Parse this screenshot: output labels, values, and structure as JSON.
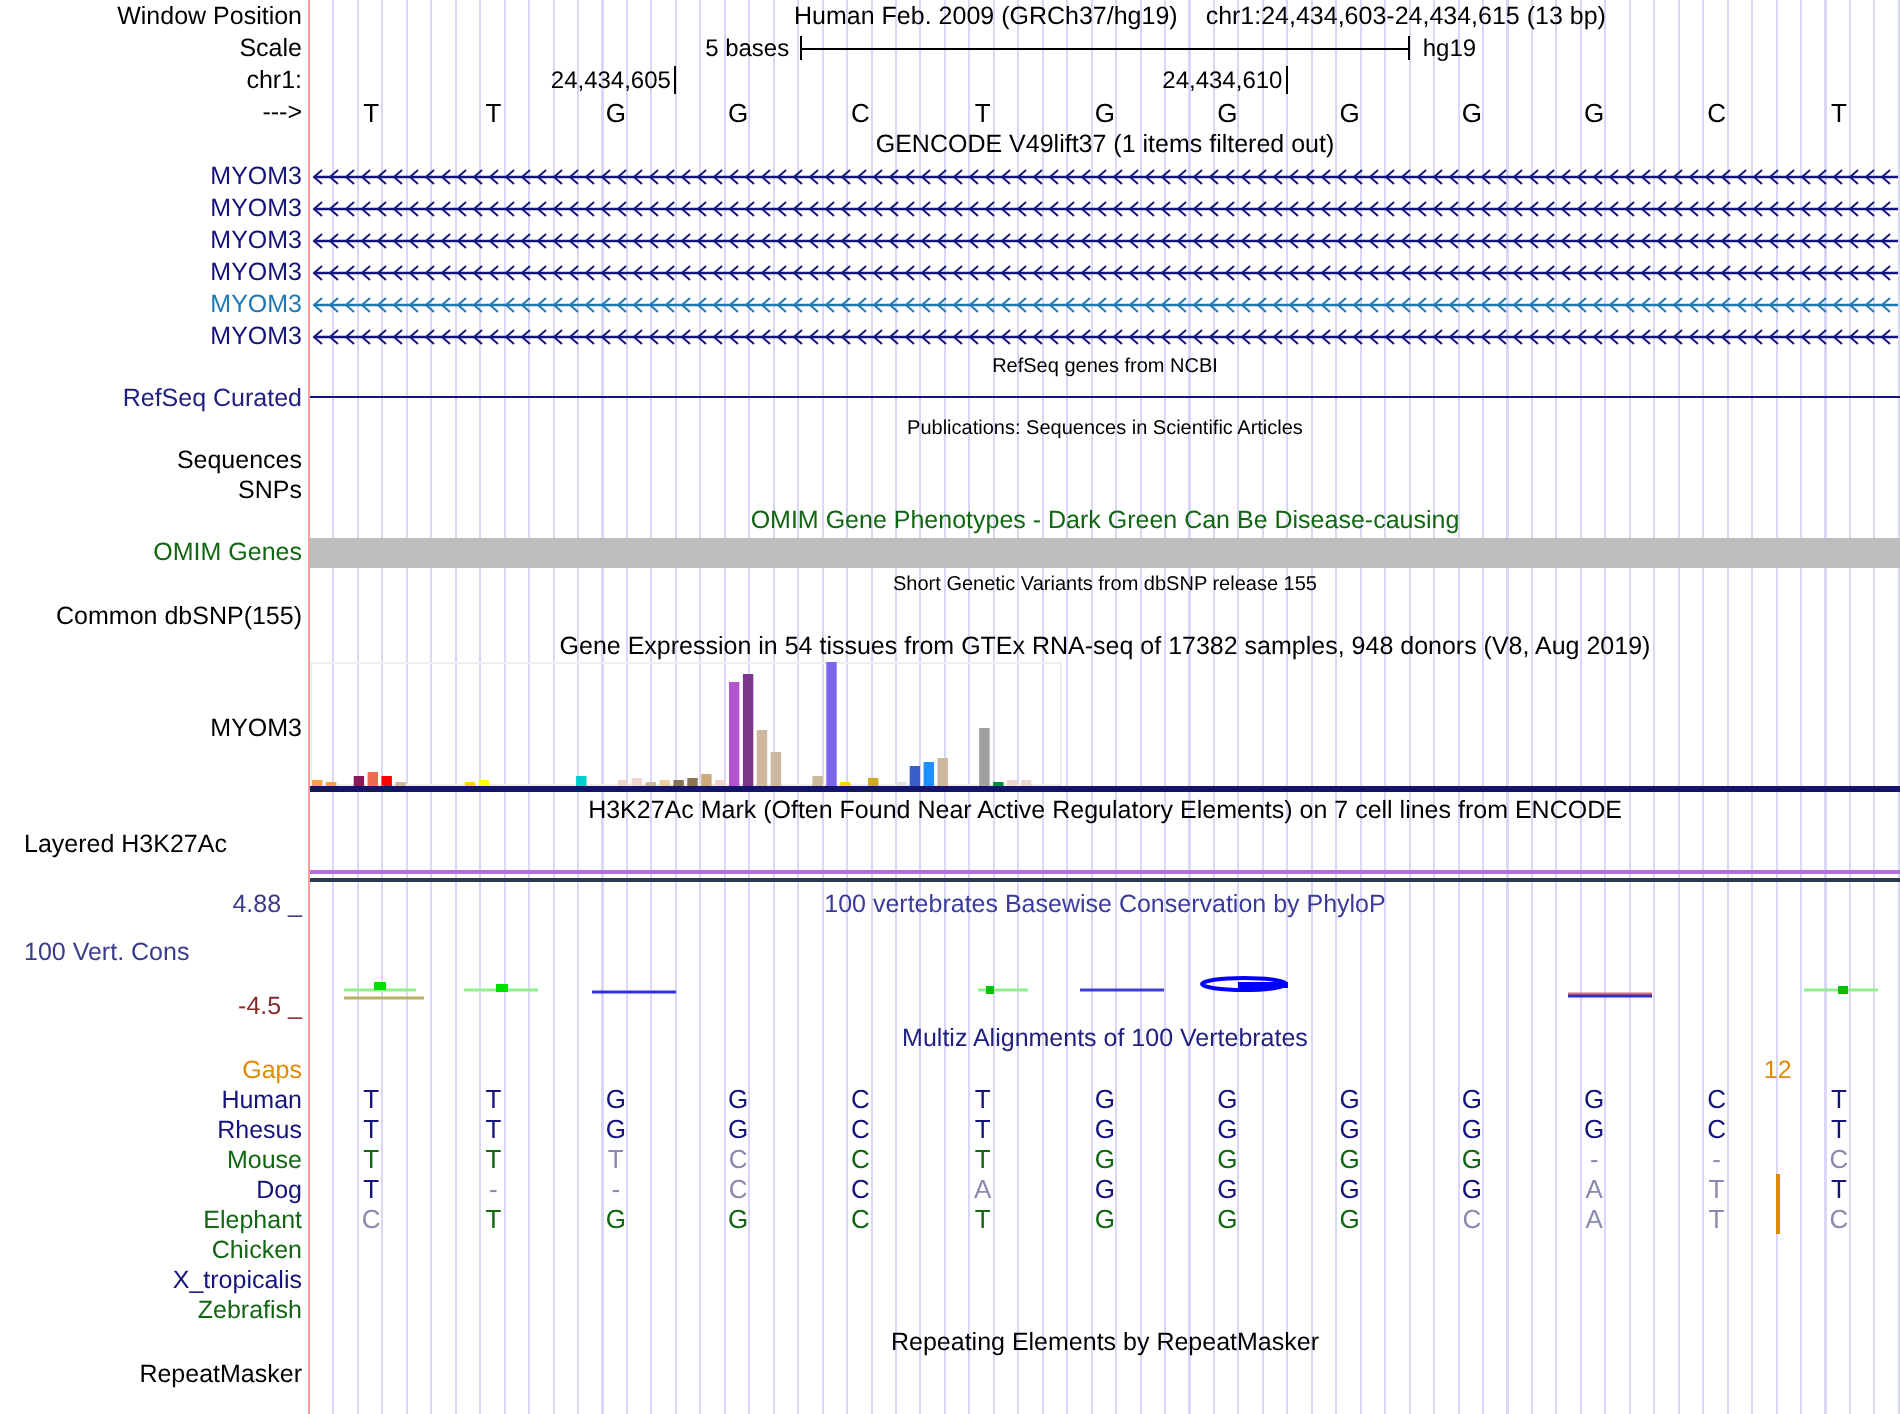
{
  "position_bar": {
    "label": "Window Position",
    "assembly": "Human Feb. 2009 (GRCh37/hg19)",
    "range": "chr1:24,434,603-24,434,615 (13 bp)"
  },
  "scale_bar": {
    "label": "Scale",
    "span": "5 bases",
    "database": "hg19"
  },
  "coordinate_bar": {
    "label": "chr1:",
    "ticks": [
      "24,434,605",
      "24,434,610"
    ]
  },
  "base_row": {
    "label": "--->",
    "bases": [
      "T",
      "T",
      "G",
      "G",
      "C",
      "T",
      "G",
      "G",
      "G",
      "G",
      "G",
      "C",
      "T"
    ]
  },
  "tracks": [
    {
      "kind": "genes",
      "title": "GENCODE V49lift37 (1 items filtered out)",
      "items": [
        {
          "label": "MYOM3",
          "color": "#14147a"
        },
        {
          "label": "MYOM3",
          "color": "#14147a"
        },
        {
          "label": "MYOM3",
          "color": "#14147a"
        },
        {
          "label": "MYOM3",
          "color": "#14147a"
        },
        {
          "label": "MYOM3",
          "color": "#1f78b4"
        },
        {
          "label": "MYOM3",
          "color": "#14147a"
        }
      ]
    },
    {
      "kind": "line",
      "title": "RefSeq genes from NCBI",
      "label": "RefSeq Curated"
    },
    {
      "kind": "annotation",
      "title": "Publications: Sequences in Scientific Articles",
      "labels": [
        "Sequences",
        "SNPs"
      ]
    },
    {
      "kind": "omim",
      "title": "OMIM Gene Phenotypes - Dark Green Can Be Disease-causing",
      "label": "OMIM Genes"
    },
    {
      "kind": "annotation",
      "title": "Short Genetic Variants from dbSNP release 155",
      "labels": [
        "Common dbSNP(155)"
      ]
    },
    {
      "kind": "expression",
      "title": "Gene Expression in 54 tissues from GTEx RNA-seq of 17382 samples, 948 donors (V8, Aug 2019)",
      "label": "MYOM3"
    },
    {
      "kind": "layered",
      "title": "H3K27Ac Mark (Often Found Near Active Regulatory Elements) on 7 cell lines from ENCODE",
      "label": "Layered H3K27Ac"
    },
    {
      "kind": "wiggle",
      "title": "100 vertebrates Basewise Conservation by PhyloP",
      "label": "100 Vert. Cons",
      "max": "4.88 _",
      "min": "-4.5 _"
    },
    {
      "kind": "multiz",
      "title": "Multiz Alignments of 100 Vertebrates",
      "gaps": {
        "label": "Gaps",
        "count": "12"
      },
      "species": [
        {
          "label": "Human",
          "color": "#14147a",
          "gap": false,
          "bases": [
            {
              "base": "T",
              "match": true
            },
            {
              "base": "T",
              "match": true
            },
            {
              "base": "G",
              "match": true
            },
            {
              "base": "G",
              "match": true
            },
            {
              "base": "C",
              "match": true
            },
            {
              "base": "T",
              "match": true
            },
            {
              "base": "G",
              "match": true
            },
            {
              "base": "G",
              "match": true
            },
            {
              "base": "G",
              "match": true
            },
            {
              "base": "G",
              "match": true
            },
            {
              "base": "G",
              "match": true
            },
            {
              "base": "C",
              "match": true
            },
            {
              "base": "T",
              "match": true
            }
          ]
        },
        {
          "label": "Rhesus",
          "color": "#14147a",
          "gap": false,
          "bases": [
            {
              "base": "T",
              "match": true
            },
            {
              "base": "T",
              "match": true
            },
            {
              "base": "G",
              "match": true
            },
            {
              "base": "G",
              "match": true
            },
            {
              "base": "C",
              "match": true
            },
            {
              "base": "T",
              "match": true
            },
            {
              "base": "G",
              "match": true
            },
            {
              "base": "G",
              "match": true
            },
            {
              "base": "G",
              "match": true
            },
            {
              "base": "G",
              "match": true
            },
            {
              "base": "G",
              "match": true
            },
            {
              "base": "C",
              "match": true
            },
            {
              "base": "T",
              "match": true
            }
          ]
        },
        {
          "label": "Mouse",
          "color": "#116611",
          "gap": false,
          "bases": [
            {
              "base": "T",
              "match": true
            },
            {
              "base": "T",
              "match": true
            },
            {
              "base": "T",
              "match": false
            },
            {
              "base": "C",
              "match": false
            },
            {
              "base": "C",
              "match": true
            },
            {
              "base": "T",
              "match": true
            },
            {
              "base": "G",
              "match": true
            },
            {
              "base": "G",
              "match": true
            },
            {
              "base": "G",
              "match": true
            },
            {
              "base": "G",
              "match": true
            },
            {
              "base": "-",
              "match": false
            },
            {
              "base": "-",
              "match": false
            },
            {
              "base": "C",
              "match": false
            }
          ]
        },
        {
          "label": "Dog",
          "color": "#14147a",
          "gap": true,
          "bases": [
            {
              "base": "T",
              "match": true
            },
            {
              "base": "-",
              "match": false
            },
            {
              "base": "-",
              "match": false
            },
            {
              "base": "C",
              "match": false
            },
            {
              "base": "C",
              "match": true
            },
            {
              "base": "A",
              "match": false
            },
            {
              "base": "G",
              "match": true
            },
            {
              "base": "G",
              "match": true
            },
            {
              "base": "G",
              "match": true
            },
            {
              "base": "G",
              "match": true
            },
            {
              "base": "A",
              "match": false
            },
            {
              "base": "T",
              "match": false
            },
            {
              "base": "T",
              "match": true
            }
          ]
        },
        {
          "label": "Elephant",
          "color": "#116611",
          "gap": true,
          "bases": [
            {
              "base": "C",
              "match": false
            },
            {
              "base": "T",
              "match": true
            },
            {
              "base": "G",
              "match": true
            },
            {
              "base": "G",
              "match": true
            },
            {
              "base": "C",
              "match": true
            },
            {
              "base": "T",
              "match": true
            },
            {
              "base": "G",
              "match": true
            },
            {
              "base": "G",
              "match": true
            },
            {
              "base": "G",
              "match": true
            },
            {
              "base": "C",
              "match": false
            },
            {
              "base": "A",
              "match": false
            },
            {
              "base": "T",
              "match": false
            },
            {
              "base": "C",
              "match": false
            }
          ]
        },
        {
          "label": "Chicken",
          "color": "#116611",
          "gap": false
        },
        {
          "label": "X_tropicalis",
          "color": "#14147a",
          "gap": false
        },
        {
          "label": "Zebrafish",
          "color": "#116611",
          "gap": false
        }
      ]
    },
    {
      "kind": "repeats",
      "title": "Repeating Elements by RepeatMasker",
      "labels": [
        "RepeatMasker"
      ]
    }
  ]
}
